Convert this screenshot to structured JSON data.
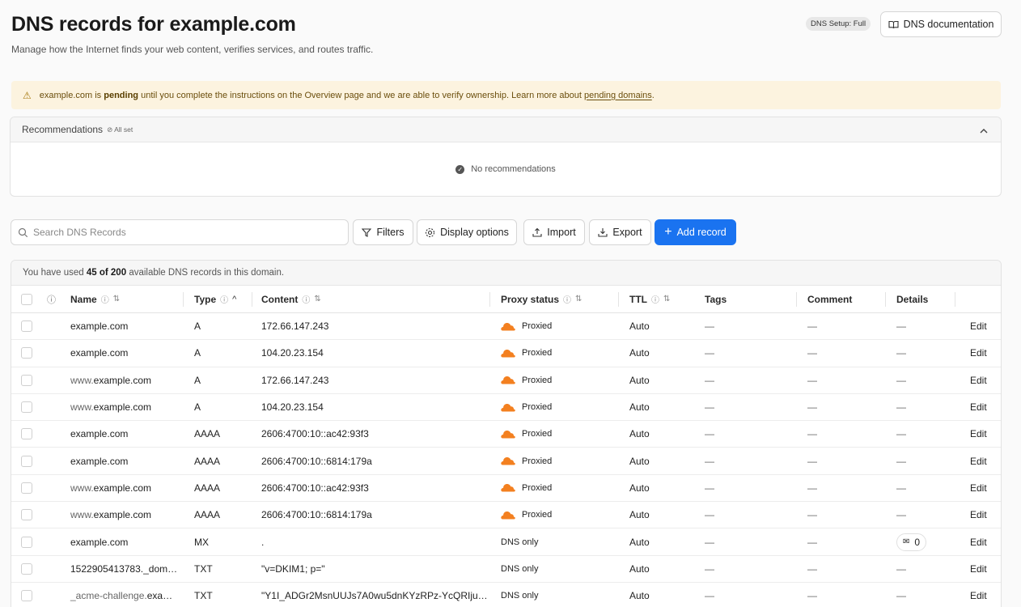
{
  "header": {
    "title": "DNS records for example.com",
    "subtitle": "Manage how the Internet finds your web content, verifies services, and routes traffic.",
    "setup_badge": "DNS Setup: Full",
    "doc_button": "DNS documentation"
  },
  "alert": {
    "prefix": "example.com is",
    "bold": "pending",
    "middle": "until you complete the instructions on the Overview page and we are able to verify ownership. Learn more about",
    "link": "pending domains",
    "suffix": "."
  },
  "recommendations": {
    "title": "Recommendations",
    "status": "All set",
    "empty_text": "No recommendations"
  },
  "toolbar": {
    "search_placeholder": "Search DNS Records",
    "filters": "Filters",
    "display_options": "Display options",
    "import": "Import",
    "export": "Export",
    "add_record": "Add record"
  },
  "usage": {
    "prefix": "You have used",
    "count": "45 of 200",
    "suffix": "available DNS records in this domain."
  },
  "table": {
    "columns": {
      "name": "Name",
      "type": "Type",
      "content": "Content",
      "proxy": "Proxy status",
      "ttl": "TTL",
      "tags": "Tags",
      "comment": "Comment",
      "details": "Details"
    },
    "dash": "—",
    "edit": "Edit",
    "rows": [
      {
        "name_prefix": "",
        "name_main": "example.com",
        "type": "A",
        "content": "172.66.147.243",
        "proxy": "Proxied",
        "proxied": true,
        "ttl": "Auto",
        "details": "—"
      },
      {
        "name_prefix": "",
        "name_main": "example.com",
        "type": "A",
        "content": "104.20.23.154",
        "proxy": "Proxied",
        "proxied": true,
        "ttl": "Auto",
        "details": "—"
      },
      {
        "name_prefix": "www.",
        "name_main": "example.com",
        "type": "A",
        "content": "172.66.147.243",
        "proxy": "Proxied",
        "proxied": true,
        "ttl": "Auto",
        "details": "—"
      },
      {
        "name_prefix": "www.",
        "name_main": "example.com",
        "type": "A",
        "content": "104.20.23.154",
        "proxy": "Proxied",
        "proxied": true,
        "ttl": "Auto",
        "details": "—"
      },
      {
        "name_prefix": "",
        "name_main": "example.com",
        "type": "AAAA",
        "content": "2606:4700:10::ac42:93f3",
        "proxy": "Proxied",
        "proxied": true,
        "ttl": "Auto",
        "details": "—"
      },
      {
        "name_prefix": "",
        "name_main": "example.com",
        "type": "AAAA",
        "content": "2606:4700:10::6814:179a",
        "proxy": "Proxied",
        "proxied": true,
        "ttl": "Auto",
        "details": "—"
      },
      {
        "name_prefix": "www.",
        "name_main": "example.com",
        "type": "AAAA",
        "content": "2606:4700:10::ac42:93f3",
        "proxy": "Proxied",
        "proxied": true,
        "ttl": "Auto",
        "details": "—"
      },
      {
        "name_prefix": "www.",
        "name_main": "example.com",
        "type": "AAAA",
        "content": "2606:4700:10::6814:179a",
        "proxy": "Proxied",
        "proxied": true,
        "ttl": "Auto",
        "details": "—"
      },
      {
        "name_prefix": "",
        "name_main": "example.com",
        "type": "MX",
        "content": ".",
        "proxy": "DNS only",
        "proxied": false,
        "ttl": "Auto",
        "details": "0"
      },
      {
        "name_prefix": "1522905413783._dom…",
        "name_main": "",
        "type": "TXT",
        "content": "\"v=DKIM1; p=\"",
        "proxy": "DNS only",
        "proxied": false,
        "ttl": "Auto",
        "details": "—"
      },
      {
        "name_prefix": "_acme-challenge.",
        "name_main": "exa…",
        "type": "TXT",
        "content": "\"Y1I_ADGr2MsnUUJs7A0wu5dnKYzRPz-YcQRIju…",
        "proxy": "DNS only",
        "proxied": false,
        "ttl": "Auto",
        "details": "—"
      }
    ]
  },
  "colors": {
    "accent": "#1a73f0",
    "proxied_cloud": "#f38020",
    "alert_bg": "#fcf3df"
  }
}
